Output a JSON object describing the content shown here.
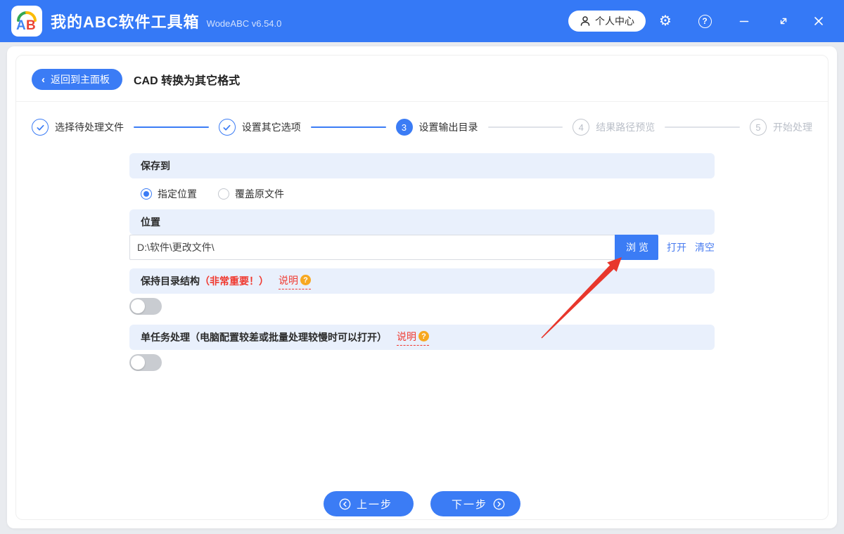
{
  "titlebar": {
    "app_name": "我的ABC软件工具箱",
    "version": "WodeABC v6.54.0",
    "logo_a": "A",
    "logo_b": "B",
    "user_center": "个人中心",
    "gear_glyph": "⚙",
    "help_glyph": "?"
  },
  "header": {
    "back_chevron": "‹",
    "back_label": "返回到主面板",
    "page_title": "CAD 转换为其它格式"
  },
  "steps": [
    {
      "label": "选择待处理文件",
      "state": "done"
    },
    {
      "label": "设置其它选项",
      "state": "done"
    },
    {
      "label": "设置输出目录",
      "state": "active",
      "number": "3"
    },
    {
      "label": "结果路径预览",
      "state": "pending",
      "number": "4"
    },
    {
      "label": "开始处理",
      "state": "pending",
      "number": "5"
    }
  ],
  "form": {
    "save_to": {
      "header": "保存到",
      "options": [
        {
          "label": "指定位置",
          "selected": true
        },
        {
          "label": "覆盖原文件",
          "selected": false
        }
      ]
    },
    "location": {
      "header": "位置",
      "path_value": "D:\\软件\\更改文件\\",
      "browse_label": "浏览",
      "open_label": "打开",
      "clear_label": "清空"
    },
    "keep_structure": {
      "title": "保持目录结构",
      "important_note": "（非常重要！）",
      "help_label": "说明",
      "help_badge": "?",
      "toggle_on": false
    },
    "single_task": {
      "title": "单任务处理（电脑配置较差或批量处理较慢时可以打开）",
      "help_label": "说明",
      "help_badge": "?",
      "toggle_on": false
    }
  },
  "footer": {
    "prev_label": "上一步",
    "next_label": "下一步"
  },
  "colors": {
    "titlebar_blue": "#3579f6",
    "accent_blue": "#3b7cf5",
    "section_bg": "#e9f0fc",
    "alert_red": "#f0392f",
    "badge_orange": "#f7a821",
    "arrow_red": "#e8372c"
  }
}
